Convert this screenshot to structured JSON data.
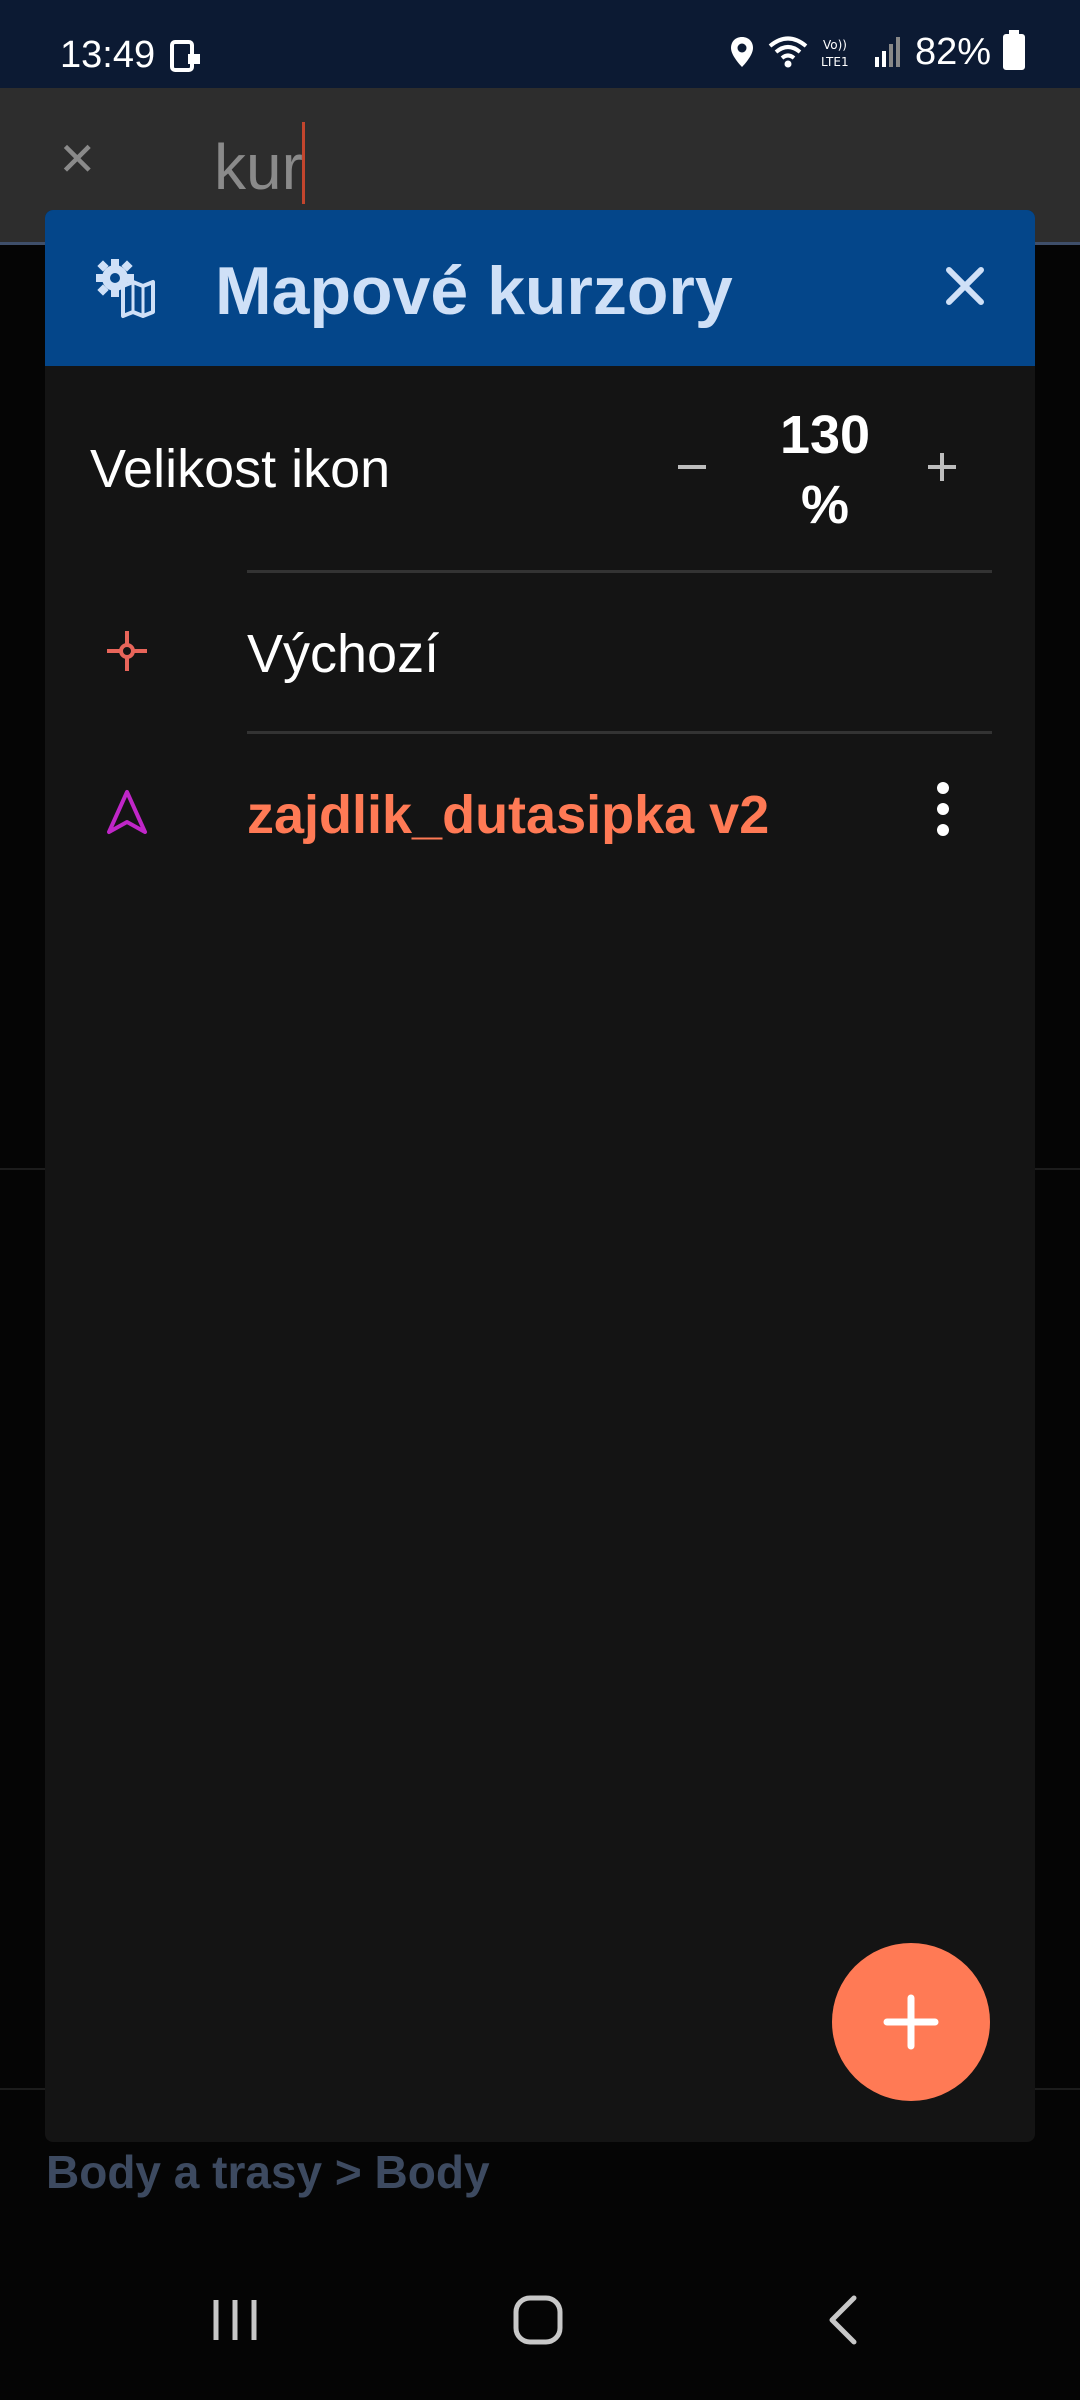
{
  "status_bar": {
    "time": "13:49",
    "battery": "82%",
    "network_label": "Vo)) LTE1"
  },
  "search": {
    "query": "kur"
  },
  "background": {
    "breadcrumb": "Body a trasy > Body"
  },
  "dialog": {
    "title": "Mapové kurzory",
    "header_icon": "settings-map-icon",
    "close_icon": "close-icon",
    "icon_size": {
      "label": "Velikost ikon",
      "value": "130",
      "unit": "%",
      "decrease_icon": "minus-icon",
      "increase_icon": "plus-icon"
    },
    "cursors": [
      {
        "label": "Výchozí",
        "icon": "crosshair-icon",
        "icon_color": "#e8655a",
        "selected": false
      },
      {
        "label": "zajdlik_dutasipka v2",
        "icon": "hollow-arrow-icon",
        "icon_color": "#c026c8",
        "selected": true
      }
    ],
    "add_button_icon": "plus-icon"
  },
  "colors": {
    "accent": "#ff7a55",
    "header": "#04468a",
    "dialog_bg": "#141414"
  }
}
